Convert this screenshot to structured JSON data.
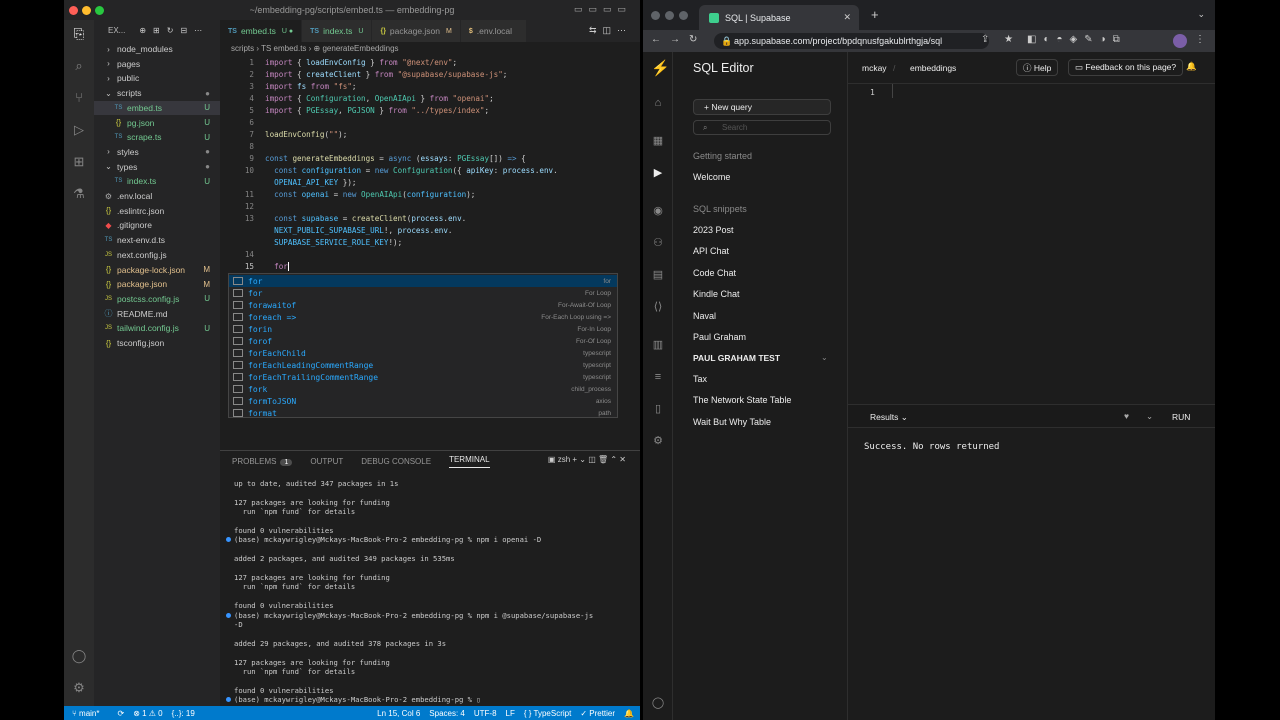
{
  "vscode": {
    "title": "~/embedding-pg/scripts/embed.ts — embedding-pg",
    "explorer_label": "EX...",
    "tree": [
      {
        "label": "node_modules",
        "kind": "folder",
        "indent": 0,
        "status": ""
      },
      {
        "label": "pages",
        "kind": "folder",
        "indent": 0,
        "status": ""
      },
      {
        "label": "public",
        "kind": "folder",
        "indent": 0,
        "status": ""
      },
      {
        "label": "scripts",
        "kind": "folder-open",
        "indent": 0,
        "status": "●"
      },
      {
        "label": "embed.ts",
        "kind": "ts",
        "indent": 1,
        "status": "U",
        "selected": true
      },
      {
        "label": "pg.json",
        "kind": "json",
        "indent": 1,
        "status": "U"
      },
      {
        "label": "scrape.ts",
        "kind": "ts",
        "indent": 1,
        "status": "U"
      },
      {
        "label": "styles",
        "kind": "folder",
        "indent": 0,
        "status": "●"
      },
      {
        "label": "types",
        "kind": "folder-open",
        "indent": 0,
        "status": "●"
      },
      {
        "label": "index.ts",
        "kind": "ts",
        "indent": 1,
        "status": "U"
      },
      {
        "label": ".env.local",
        "kind": "env",
        "indent": 0,
        "status": ""
      },
      {
        "label": ".eslintrc.json",
        "kind": "json",
        "indent": 0,
        "status": ""
      },
      {
        "label": ".gitignore",
        "kind": "git",
        "indent": 0,
        "status": ""
      },
      {
        "label": "next-env.d.ts",
        "kind": "ts",
        "indent": 0,
        "status": ""
      },
      {
        "label": "next.config.js",
        "kind": "js",
        "indent": 0,
        "status": ""
      },
      {
        "label": "package-lock.json",
        "kind": "json",
        "indent": 0,
        "status": "M"
      },
      {
        "label": "package.json",
        "kind": "json",
        "indent": 0,
        "status": "M"
      },
      {
        "label": "postcss.config.js",
        "kind": "js",
        "indent": 0,
        "status": "U"
      },
      {
        "label": "README.md",
        "kind": "md",
        "indent": 0,
        "status": ""
      },
      {
        "label": "tailwind.config.js",
        "kind": "js",
        "indent": 0,
        "status": "U"
      },
      {
        "label": "tsconfig.json",
        "kind": "json",
        "indent": 0,
        "status": ""
      }
    ],
    "tabs": [
      {
        "type": "TS",
        "label": "embed.ts",
        "mark": "U ●",
        "active": true
      },
      {
        "type": "TS",
        "label": "index.ts",
        "mark": "U",
        "active": false
      },
      {
        "type": "{}",
        "label": "package.json",
        "mark": "M",
        "active": false
      },
      {
        "type": "$",
        "label": ".env.local",
        "mark": "",
        "active": false
      }
    ],
    "breadcrumb": "scripts › TS embed.ts › ⊕ generateEmbeddings",
    "suggestions": [
      {
        "label": "for",
        "detail": "for",
        "selected": true
      },
      {
        "label": "for",
        "detail": "For Loop"
      },
      {
        "label": "forawaitof",
        "detail": "For-Await-Of Loop"
      },
      {
        "label": "foreach =>",
        "detail": "For-Each Loop using =>"
      },
      {
        "label": "forin",
        "detail": "For-In Loop"
      },
      {
        "label": "forof",
        "detail": "For-Of Loop"
      },
      {
        "label": "forEachChild",
        "detail": "typescript"
      },
      {
        "label": "forEachLeadingCommentRange",
        "detail": "typescript"
      },
      {
        "label": "forEachTrailingCommentRange",
        "detail": "typescript"
      },
      {
        "label": "fork",
        "detail": "child_process"
      },
      {
        "label": "formToJSON",
        "detail": "axios"
      },
      {
        "label": "format",
        "detail": "path"
      }
    ],
    "panel_tabs": {
      "problems": "PROBLEMS",
      "problems_count": "1",
      "output": "OUTPUT",
      "debug": "DEBUG CONSOLE",
      "terminal": "TERMINAL",
      "shell": "zsh"
    },
    "terminal_lines": [
      {
        "text": "up to date, audited 347 packages in 1s",
        "dot": false
      },
      {
        "text": "",
        "dot": false
      },
      {
        "text": "127 packages are looking for funding",
        "dot": false
      },
      {
        "text": "  run `npm fund` for details",
        "dot": false
      },
      {
        "text": "",
        "dot": false
      },
      {
        "text": "found 0 vulnerabilities",
        "dot": false
      },
      {
        "text": "(base) mckaywrigley@Mckays-MacBook-Pro-2 embedding-pg % npm i openai -D",
        "dot": true
      },
      {
        "text": "",
        "dot": false
      },
      {
        "text": "added 2 packages, and audited 349 packages in 535ms",
        "dot": false
      },
      {
        "text": "",
        "dot": false
      },
      {
        "text": "127 packages are looking for funding",
        "dot": false
      },
      {
        "text": "  run `npm fund` for details",
        "dot": false
      },
      {
        "text": "",
        "dot": false
      },
      {
        "text": "found 0 vulnerabilities",
        "dot": false
      },
      {
        "text": "(base) mckaywrigley@Mckays-MacBook-Pro-2 embedding-pg % npm i @supabase/supabase-js",
        "dot": true
      },
      {
        "text": "-D",
        "dot": false
      },
      {
        "text": "",
        "dot": false
      },
      {
        "text": "added 29 packages, and audited 378 packages in 3s",
        "dot": false
      },
      {
        "text": "",
        "dot": false
      },
      {
        "text": "127 packages are looking for funding",
        "dot": false
      },
      {
        "text": "  run `npm fund` for details",
        "dot": false
      },
      {
        "text": "",
        "dot": false
      },
      {
        "text": "found 0 vulnerabilities",
        "dot": false
      },
      {
        "text": "(base) mckaywrigley@Mckays-MacBook-Pro-2 embedding-pg % ▯",
        "dot": true
      }
    ],
    "status": {
      "branch": "main*",
      "sync": "⟳",
      "errors": "⊗ 1 ⚠ 0",
      "scope": "{..}: 19",
      "position": "Ln 15, Col 6",
      "spaces": "Spaces: 4",
      "encoding": "UTF-8",
      "eol": "LF",
      "language": "{ } TypeScript",
      "prettier": "✓ Prettier"
    }
  },
  "chrome": {
    "tab_title": "SQL | Supabase",
    "url": "app.supabase.com/project/bpdqnusfgakublrthgja/sql"
  },
  "supabase": {
    "heading": "SQL Editor",
    "new_query": "+  New query",
    "search_placeholder": "Search",
    "getting_started": "Getting started",
    "welcome": "Welcome",
    "snippets_header": "SQL snippets",
    "snippets": [
      "2023 Post",
      "API Chat",
      "Code Chat",
      "Kindle Chat",
      "Naval",
      "Paul Graham"
    ],
    "active_snippet": "PAUL GRAHAM TEST",
    "snippets_more": [
      "Tax",
      "The Network State Table",
      "Wait But Why Table"
    ],
    "crumb_org": "mckay",
    "crumb_project": "embeddings",
    "help": "Help",
    "feedback": "Feedback on this page?",
    "line_number": "1",
    "results_label": "Results",
    "run_label": "RUN",
    "result_message": "Success. No rows returned"
  },
  "colors": {
    "supabase_green": "#3ecf8e",
    "vscode_blue": "#007acc"
  }
}
